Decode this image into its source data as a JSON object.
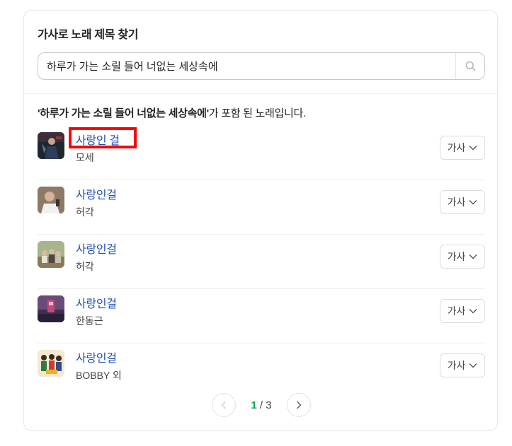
{
  "widget": {
    "title": "가사로 노래 제목 찾기"
  },
  "search": {
    "value": "하루가 가는 소릴 들어 너없는 세상속에"
  },
  "summary": {
    "query": "'하루가 가는 소릴 들어 너없는 세상속에'",
    "suffix": "가 포함 된 노래입니다."
  },
  "songs": [
    {
      "title": "사랑인 걸",
      "artist": "모세",
      "lyrics_label": "가사"
    },
    {
      "title": "사랑인걸",
      "artist": "허각",
      "lyrics_label": "가사"
    },
    {
      "title": "사랑인걸",
      "artist": "허각",
      "lyrics_label": "가사"
    },
    {
      "title": "사랑인걸",
      "artist": "한동근",
      "lyrics_label": "가사"
    },
    {
      "title": "사랑인걸",
      "artist": "BOBBY 외",
      "lyrics_label": "가사"
    }
  ],
  "pagination": {
    "current": "1",
    "separator": " / ",
    "total": "3"
  },
  "colors": {
    "link": "#1d4fb2",
    "current_page": "#03a94d",
    "highlight": "#ff0000"
  }
}
